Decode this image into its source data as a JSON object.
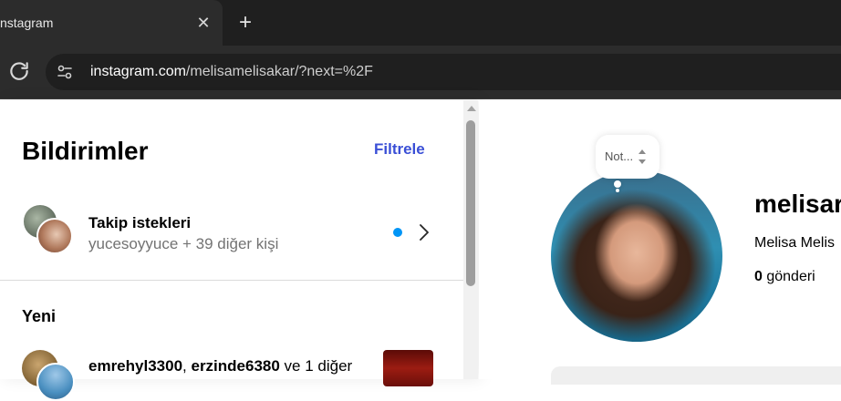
{
  "browser": {
    "tab_title": "nstagram",
    "url_host": "instagram.com",
    "url_path": "/melisamelisakar/?next=%2F"
  },
  "notifications": {
    "title": "Bildirimler",
    "filter_label": "Filtrele",
    "follow_requests": {
      "title": "Takip istekleri",
      "subtitle": "yucesoyyuce + 39 diğer kişi"
    },
    "section_label": "Yeni",
    "item": {
      "user1": "emrehyl3300",
      "sep": ", ",
      "user2": "erzinde6380",
      "rest": " ve 1 diğer"
    }
  },
  "profile": {
    "note": "Not...",
    "username": "melisar",
    "full_name": "Melisa Melis",
    "posts_count": "0",
    "posts_label": " gönderi"
  },
  "colors": {
    "accent": "#3a4fd6",
    "unread_dot": "#0095f6"
  }
}
